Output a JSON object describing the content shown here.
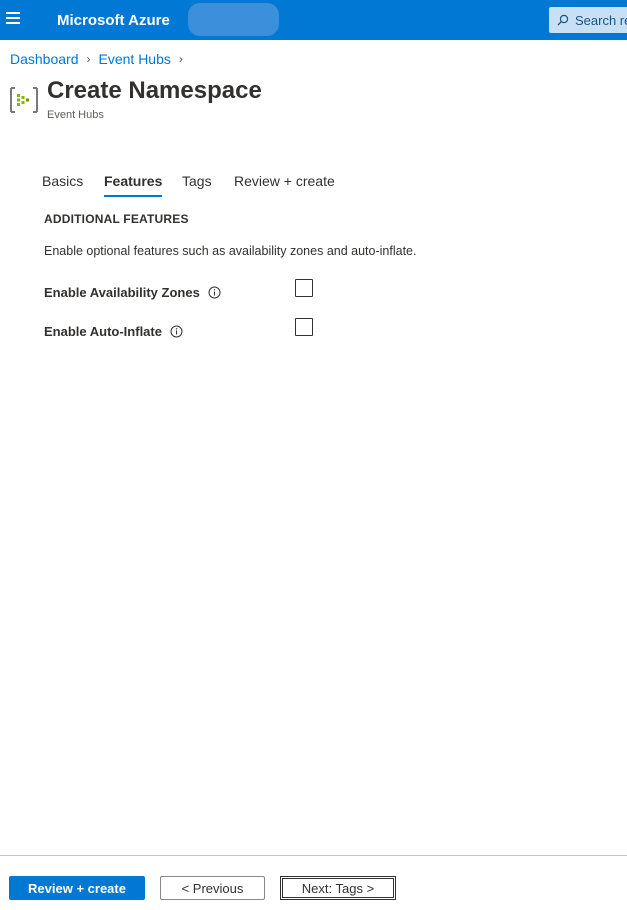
{
  "header": {
    "brand": "Microsoft Azure",
    "search_placeholder": "Search re",
    "accent_color": "#0078d4"
  },
  "breadcrumb": [
    "Dashboard",
    "Event Hubs"
  ],
  "page": {
    "title": "Create Namespace",
    "subtitle": "Event Hubs",
    "icon": "event-hubs-icon"
  },
  "tabs": [
    {
      "label": "Basics",
      "active": false
    },
    {
      "label": "Features",
      "active": true
    },
    {
      "label": "Tags",
      "active": false
    },
    {
      "label": "Review + create",
      "active": false
    }
  ],
  "section": {
    "heading": "ADDITIONAL FEATURES",
    "description": "Enable optional features such as availability zones and auto-inflate."
  },
  "fields": [
    {
      "label": "Enable Availability Zones",
      "checked": false
    },
    {
      "label": "Enable Auto-Inflate",
      "checked": false
    }
  ],
  "footer": {
    "review_create": "Review + create",
    "previous": "< Previous",
    "next": "Next: Tags >"
  }
}
